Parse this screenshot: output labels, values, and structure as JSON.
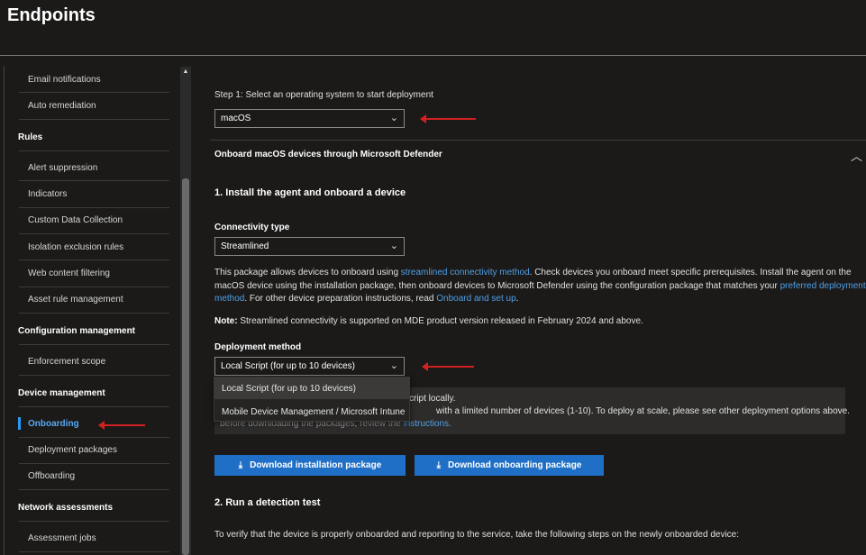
{
  "header": {
    "title": "Endpoints"
  },
  "sidebar": {
    "items": [
      {
        "label": "Email notifications"
      },
      {
        "label": "Auto remediation"
      }
    ],
    "rules": {
      "heading": "Rules",
      "items": [
        "Alert suppression",
        "Indicators",
        "Custom Data Collection",
        "Isolation exclusion rules",
        "Web content filtering",
        "Asset rule management"
      ]
    },
    "config": {
      "heading": "Configuration management",
      "items": [
        "Enforcement scope"
      ]
    },
    "device": {
      "heading": "Device management",
      "active": "Onboarding",
      "items": [
        "Deployment packages",
        "Offboarding"
      ]
    },
    "network": {
      "heading": "Network assessments",
      "items": [
        "Assessment jobs"
      ]
    }
  },
  "main": {
    "step1_label": "Step 1: Select an operating system to start deployment",
    "os_value": "macOS",
    "section_title": "Onboard macOS devices through Microsoft Defender",
    "install_heading": "1. Install the agent and onboard a device",
    "connectivity_label": "Connectivity type",
    "connectivity_value": "Streamlined",
    "desc1_a": "This package allows devices to onboard using ",
    "desc1_link": "streamlined connectivity method",
    "desc1_b": ". Check devices you onboard meet specific prerequisites. Install the agent on the",
    "desc2_a": "macOS device using the installation package, then onboard devices to Microsoft Defender using the configuration package that matches your ",
    "desc2_link": "preferred deployment",
    "desc3_link1": "method",
    "desc3_a": ". For other device preparation instructions, read ",
    "desc3_link2": "Onboard and set up",
    "desc3_b": ".",
    "note_bold": "Note:",
    "note_text": " Streamlined connectivity is supported on MDE product version released in February 2024 and above.",
    "deploy_label": "Deployment method",
    "deploy_value": "Local Script (for up to 10 devices)",
    "dropdown_options": [
      "Local Script (for up to 10 devices)",
      "Mobile Device Management / Microsoft Intune"
    ],
    "info_line1": "cript locally.",
    "info_line2": "with a limited number of devices (1-10). To deploy at scale, please see other deployment options above.",
    "info_line3_a": "before downloading the packages, review the ",
    "info_line3_link": "instructions",
    "info_line3_b": ".",
    "btn_install": "Download installation package",
    "btn_onboard": "Download onboarding package",
    "detect_heading": "2. Run a detection test",
    "detect_text": "To verify that the device is properly onboarded and reporting to the service, take the following steps on the newly onboarded device:"
  },
  "icons": {
    "chevron": "chevron-down-icon",
    "collapse": "chevron-up-icon",
    "download": "download-icon"
  },
  "colors": {
    "accent": "#1f6fc6",
    "link": "#4f9fe6",
    "annotation": "#d32020"
  }
}
